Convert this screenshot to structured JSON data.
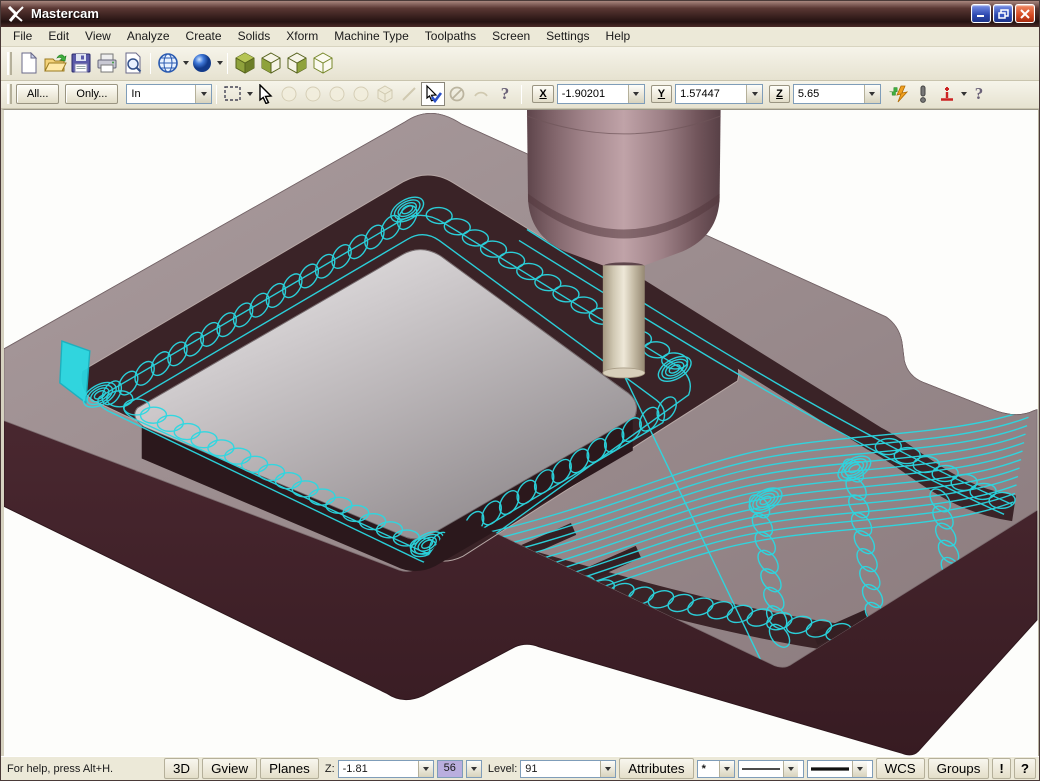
{
  "window": {
    "title": "Mastercam"
  },
  "window_controls": {
    "minimize": "minimize",
    "restore": "restore",
    "close": "close"
  },
  "menu": {
    "items": [
      "File",
      "Edit",
      "View",
      "Analyze",
      "Create",
      "Solids",
      "Xform",
      "Machine Type",
      "Toolpaths",
      "Screen",
      "Settings",
      "Help"
    ]
  },
  "toolbar_file": {
    "icons": [
      "new-file",
      "open-file",
      "save-file",
      "print",
      "print-preview",
      "gview-globe",
      "shading-sphere",
      "view-cube-shaded",
      "view-cube-left",
      "view-cube-right",
      "view-cube-wireframe"
    ]
  },
  "selection_toolbar": {
    "all_label": "All...",
    "only_label": "Only...",
    "in_filter_value": "In",
    "icons": [
      "window-select",
      "pointer-cursor",
      "entity-ghost-1",
      "entity-ghost-2",
      "entity-ghost-3",
      "entity-ghost-4",
      "solid-ghost",
      "edge-ghost",
      "end-selection-check",
      "clear-selection-null",
      "partial-ghost",
      "help"
    ]
  },
  "coordinates": {
    "x_label": "X",
    "x_value": "-1.90201",
    "y_label": "Y",
    "y_value": "1.57447",
    "z_label": "Z",
    "z_value": "5.65",
    "icons": [
      "autocursor",
      "fastpoint-exclaim",
      "z-depth-point",
      "help"
    ]
  },
  "statusbar": {
    "help_text": "For help, press Alt+H.",
    "view_3d": "3D",
    "gview": "Gview",
    "planes": "Planes",
    "z_label": "Z:",
    "z_value": "-1.81",
    "color_value": "56",
    "level_label": "Level:",
    "level_value": "91",
    "attributes": "Attributes",
    "point_style": "*",
    "wcs": "WCS",
    "groups": "Groups",
    "warn": "!",
    "help": "?"
  },
  "viewport": {
    "content": "3D shaded machining simulation of T-shaped pocketed part with cyan toolpaths and vertical mill tool",
    "toolpath_color": "#2bd8e2",
    "stock_wall_color": "#4a2830",
    "stock_top_color": "#9c8c8f",
    "pocket_floor_color": "#3a2428",
    "island_light": "#efedee",
    "island_dark": "#8e888b",
    "tool_holder_color": "#9b7d83",
    "tool_shank_color": "#ddd6c6",
    "level_chip_color": "#b9aede"
  }
}
